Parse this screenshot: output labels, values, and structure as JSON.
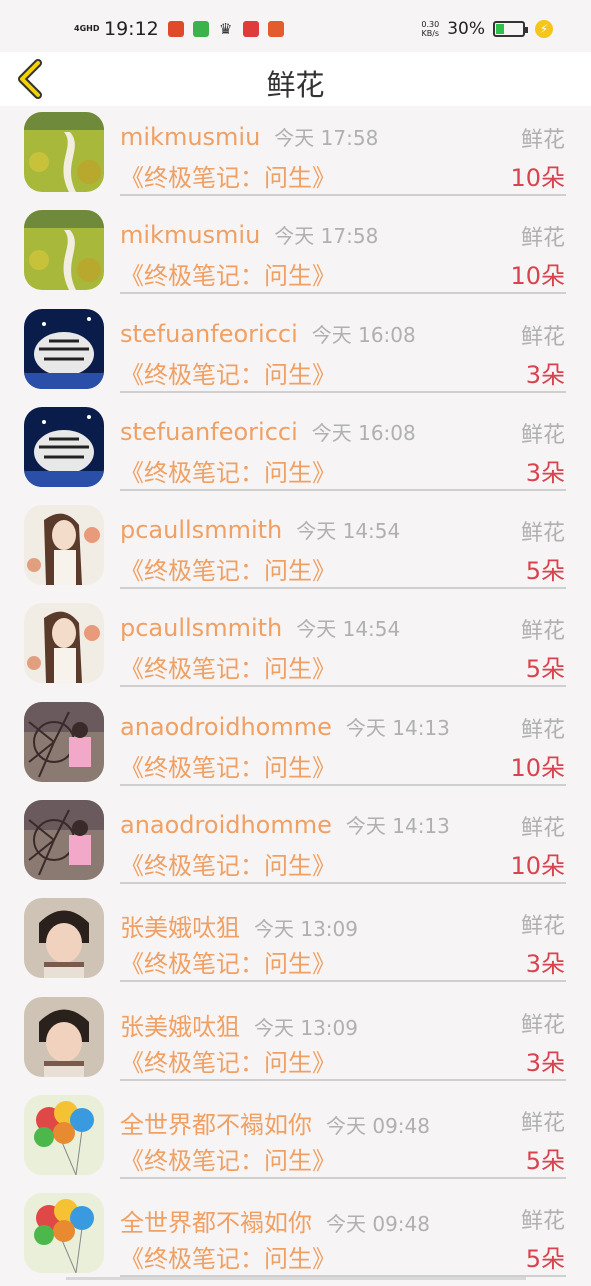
{
  "status": {
    "network": "4GHD",
    "time": "19:12",
    "speed_value": "0.30",
    "speed_unit": "KB/s",
    "battery": "30%",
    "battery_level": 0.3,
    "app_icon_colors": [
      "#e04a2a",
      "#3cb34a",
      "#333333",
      "#e03b3b",
      "#e35c2e"
    ]
  },
  "nav": {
    "title": "鲜花",
    "back_icon": "chevron-left-icon"
  },
  "colors": {
    "name": "#f0a063",
    "time": "#b0b0b0",
    "count": "#d9434f",
    "back": "#f5d200"
  },
  "items": [
    {
      "user": "mikmusmiu",
      "time": "今天 17:58",
      "book": "《终极笔记：问生》",
      "gift": "鲜花",
      "count": "10朵"
    },
    {
      "user": "mikmusmiu",
      "time": "今天 17:58",
      "book": "《终极笔记：问生》",
      "gift": "鲜花",
      "count": "10朵"
    },
    {
      "user": "stefuanfeoricci",
      "time": "今天 16:08",
      "book": "《终极笔记：问生》",
      "gift": "鲜花",
      "count": "3朵"
    },
    {
      "user": "stefuanfeoricci",
      "time": "今天 16:08",
      "book": "《终极笔记：问生》",
      "gift": "鲜花",
      "count": "3朵"
    },
    {
      "user": "pcaullsmmith",
      "time": "今天 14:54",
      "book": "《终极笔记：问生》",
      "gift": "鲜花",
      "count": "5朵"
    },
    {
      "user": "pcaullsmmith",
      "time": "今天 14:54",
      "book": "《终极笔记：问生》",
      "gift": "鲜花",
      "count": "5朵"
    },
    {
      "user": "anaodroidhomme",
      "time": "今天 14:13",
      "book": "《终极笔记：问生》",
      "gift": "鲜花",
      "count": "10朵"
    },
    {
      "user": "anaodroidhomme",
      "time": "今天 14:13",
      "book": "《终极笔记：问生》",
      "gift": "鲜花",
      "count": "10朵"
    },
    {
      "user": "张美娥呔狙",
      "time": "今天 13:09",
      "book": "《终极笔记：问生》",
      "gift": "鲜花",
      "count": "3朵"
    },
    {
      "user": "张美娥呔狙",
      "time": "今天 13:09",
      "book": "《终极笔记：问生》",
      "gift": "鲜花",
      "count": "3朵"
    },
    {
      "user": "全世界都不褟如你",
      "time": "今天 09:48",
      "book": "《终极笔记：问生》",
      "gift": "鲜花",
      "count": "5朵"
    },
    {
      "user": "全世界都不褟如你",
      "time": "今天 09:48",
      "book": "《终极笔记：问生》",
      "gift": "鲜花",
      "count": "5朵"
    }
  ]
}
